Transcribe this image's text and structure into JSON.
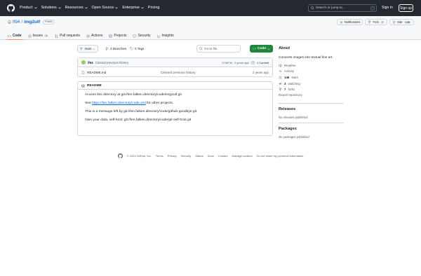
{
  "header": {
    "nav": [
      "Product",
      "Solutions",
      "Resources",
      "Open Source",
      "Enterprise",
      "Pricing"
    ],
    "search_placeholder": "Search or jump to...",
    "search_shortcut": "/",
    "signin": "Sign in",
    "signup": "Sign up"
  },
  "repo": {
    "owner": "lf94",
    "separator": "/",
    "name": "img2utf",
    "visibility": "Public",
    "actions": {
      "notifications": "Notifications",
      "fork_label": "Fork",
      "fork_count": "7",
      "star_label": "Star",
      "star_count": "146"
    },
    "tabs": [
      {
        "label": "Code"
      },
      {
        "label": "Issues",
        "badge": "1"
      },
      {
        "label": "Pull requests"
      },
      {
        "label": "Actions"
      },
      {
        "label": "Projects"
      },
      {
        "label": "Security"
      },
      {
        "label": "Insights"
      }
    ]
  },
  "main": {
    "branch": "main",
    "branches": "2 Branches",
    "tags": "0 Tags",
    "gofile_placeholder": "Go to file",
    "code_button": "Code",
    "commit": {
      "user": "lf94",
      "message": "Cleared previous history",
      "hash": "07d87fa",
      "time": "2 years ago",
      "commits": "1 Commit"
    },
    "files": [
      {
        "name": "README.md",
        "message": "Cleared previous history",
        "time": "2 years ago"
      }
    ],
    "readme": {
      "title": "README",
      "line1": "Access this directory at git://len.falken.directory/code/img2utf.git",
      "line2_prefix": "See ",
      "line2_link": "https://len.falken.directory/code.xml",
      "line2_suffix": " for other projects.",
      "line3": "This is a message left by git://len.falken.directory/code/github-goodbye.git",
      "line4": "Own your data, self-host: git://len.falken.directory/code/git-self-host.git"
    }
  },
  "sidebar": {
    "about_title": "About",
    "description": "Converts images into textual line art.",
    "items": [
      {
        "icon": "book-icon",
        "label": "Readme"
      },
      {
        "icon": "pulse-icon",
        "label": "Activity"
      },
      {
        "icon": "star-icon",
        "count": "146",
        "label": "stars"
      },
      {
        "icon": "eye-icon",
        "count": "3",
        "label": "watching"
      },
      {
        "icon": "fork-icon",
        "count": "7",
        "label": "forks"
      }
    ],
    "report": "Report repository",
    "releases_title": "Releases",
    "releases_text": "No releases published",
    "packages_title": "Packages",
    "packages_text": "No packages published"
  },
  "footer": {
    "copyright": "© 2024 GitHub, Inc.",
    "links": [
      "Terms",
      "Privacy",
      "Security",
      "Status",
      "Docs",
      "Contact",
      "Manage cookies",
      "Do not share my personal information"
    ]
  },
  "colors": {
    "header_bg": "#24292f",
    "link": "#0969da",
    "code_button": "#1f883d",
    "active_tab": "#fd8c73"
  }
}
